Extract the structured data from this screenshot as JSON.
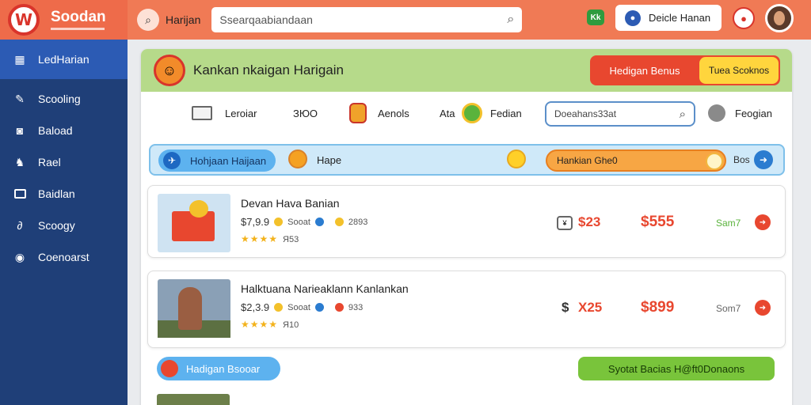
{
  "brand": {
    "name": "Soodan",
    "logo_letter": "W"
  },
  "sidebar": {
    "items": [
      {
        "label": "LedHarian",
        "icon": "grid-icon",
        "active": true
      },
      {
        "label": "Scooling",
        "icon": "wrench-icon",
        "active": false
      },
      {
        "label": "Baload",
        "icon": "chat-icon",
        "active": false
      },
      {
        "label": "Rael",
        "icon": "chess-icon",
        "active": false
      },
      {
        "label": "Baidlan",
        "icon": "monitor-icon",
        "active": false
      },
      {
        "label": "Scoogy",
        "icon": "link-icon",
        "active": false
      },
      {
        "label": "Coenoarst",
        "icon": "bubble-icon",
        "active": false
      }
    ]
  },
  "topbar": {
    "title": "Harijan",
    "search_text": "Ssearqaabiandaan",
    "badge_text": "Kk",
    "user_label": "Deicle Hanan"
  },
  "panel": {
    "title": "Kankan nkaigan Harigain",
    "header_btn_red": "Hedigan Benus",
    "header_btn_yellow": "Tuea Scoknos",
    "filters": [
      {
        "label": "Leroiar"
      },
      {
        "label": "ЗЮО"
      },
      {
        "label": "Aenols"
      },
      {
        "label": "Ata"
      },
      {
        "label": "Fedian"
      }
    ],
    "mini_search_text": "Doeahans33at",
    "after_search_label": "Feogian",
    "blue_pill": "Hohjaan Haijaan",
    "hope_label": "Hape",
    "orange_pill": "Hankian Ghe0",
    "go_label": "Bos"
  },
  "cards": [
    {
      "title": "Devan Hava Banian",
      "price": "$7,9.9",
      "sub1": "Sooat",
      "rating_value": "2893",
      "rating_count": "Я53",
      "stars": "★★★★",
      "icon_text": "¥",
      "p1": "$23",
      "p2": "$555",
      "green": "Sam7"
    },
    {
      "title": "Halktuana Narieaklann Kanlankan",
      "price": "$2,3.9",
      "sub1": "Sooat",
      "rating_value": "933",
      "rating_count": "Я10",
      "stars": "★★★★",
      "icon_text": "$",
      "p1": "X25",
      "p2": "$899",
      "green": "Som7"
    }
  ],
  "bottom": {
    "left_button": "Hadigan Bsooar",
    "right_button": "Syotat Bacias H@ft0Donaons"
  }
}
